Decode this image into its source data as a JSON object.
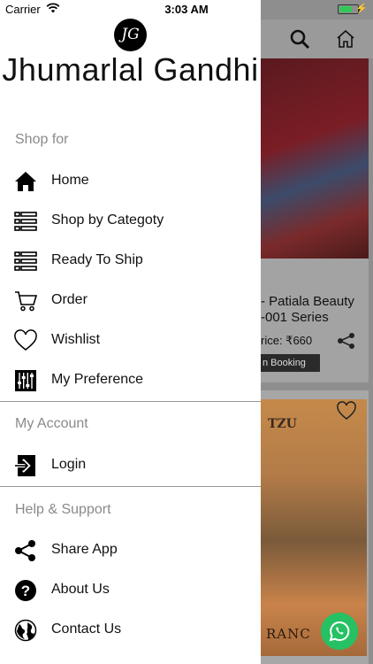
{
  "status_bar": {
    "carrier": "Carrier",
    "time": "3:03 AM",
    "battery_level": 0.7,
    "battery_color": "#34c759"
  },
  "drawer": {
    "logo_initials": "JG",
    "brand_name": "Jhumarlal Gandhi",
    "sections": {
      "shop_for": "Shop for",
      "my_account": "My Account",
      "help_support": "Help & Support"
    },
    "items": {
      "home": {
        "label": "Home",
        "icon": "home-icon"
      },
      "shop_by_category": {
        "label": "Shop by Categoty",
        "icon": "list-icon"
      },
      "ready_to_ship": {
        "label": "Ready To Ship",
        "icon": "list-icon"
      },
      "order": {
        "label": "Order",
        "icon": "cart-icon"
      },
      "wishlist": {
        "label": "Wishlist",
        "icon": "heart-icon"
      },
      "my_preference": {
        "label": "My Preference",
        "icon": "sliders-icon"
      },
      "login": {
        "label": "Login",
        "icon": "login-icon"
      },
      "share_app": {
        "label": "Share App",
        "icon": "share-icon"
      },
      "about_us": {
        "label": "About Us",
        "icon": "question-icon"
      },
      "contact_us": {
        "label": "Contact Us",
        "icon": "globe-icon"
      }
    }
  },
  "background": {
    "product1": {
      "title_line1": "- Patiala Beauty",
      "title_line2": "-001 Series",
      "price": "rice: ₹660",
      "booking": "n Booking"
    },
    "product2": {
      "brand": "TZU",
      "word": "RANC"
    },
    "colors": {
      "overlay": "#8e8e8e",
      "whatsapp": "#25c163"
    }
  }
}
